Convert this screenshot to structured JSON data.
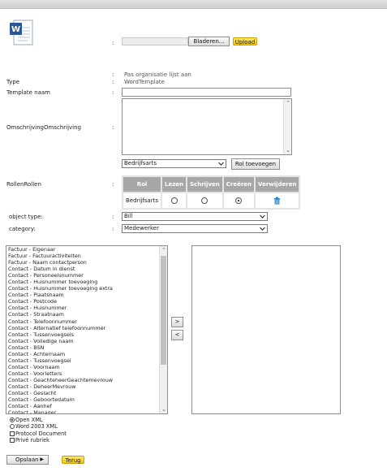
{
  "header": {},
  "upload": {
    "browse_label": "Bladeren...",
    "upload_label": "Upload"
  },
  "organisation_text": "Pas organisatie lijst aan",
  "type": {
    "label": "Type",
    "value": "WordTemplate"
  },
  "template_name": {
    "label": "Template naam",
    "value": ""
  },
  "description": {
    "label": "OmschrijvingOmschrijving",
    "value": ""
  },
  "role_select": {
    "value": "Bedrijfsarts",
    "add_label": "Rol toevoegen"
  },
  "roles": {
    "label": "RollenRollen",
    "headers": [
      "Rol",
      "Lezen",
      "Schrijven",
      "Creëren",
      "Verwijderen"
    ],
    "rows": [
      {
        "name": "Bedrijfsarts",
        "lezen": false,
        "schrijven": false,
        "creeren": true
      }
    ]
  },
  "object_type": {
    "label": "object type:",
    "value": "Bill"
  },
  "category": {
    "label": "category:",
    "value": "Medewerker"
  },
  "fields_list": [
    "Factuur - Eigenaar",
    "Factuur - Factuuractiviteiten",
    "Factuur - Naam contactperson",
    "Contact - Datum in dienst",
    "Contact - Personeelsnummer",
    "Contact - Huisnummer toevoeging",
    "Contact - Huisnummer toevoeging extra",
    "Contact - Plaatsnaam",
    "Contact - Postcode",
    "Contact - Huisnummer",
    "Contact - Straatnaam",
    "Contact - Telefoonnummer",
    "Contact - Alternatief telefoonnummer",
    "Contact - Tussenvoegsels",
    "Contact - Volledige naam",
    "Contact - BSN",
    "Contact - Achternaam",
    "Contact - Tussenvoegsel",
    "Contact - Voornaam",
    "Contact - Voorletters",
    "Contact - GeachteheerGeachtemevrouw",
    "Contact - DeheerMevrouw",
    "Contact - Geslacht",
    "Contact - Geboortedatum",
    "Contact - Aanhef",
    "Contact - Manager"
  ],
  "move_right_label": ">",
  "move_left_label": "<",
  "format_options": [
    {
      "label": "Open XML",
      "selected": true
    },
    {
      "label": "Word 2003 XML",
      "selected": false
    }
  ],
  "checkbox_options": [
    {
      "label": "Protocol Document",
      "checked": false
    },
    {
      "label": "Privé rubriek",
      "checked": false
    }
  ],
  "footer": {
    "save_label": "Opslaan",
    "back_label": "Terug"
  },
  "colors": {
    "accent": "#f6c400",
    "header_grey": "#a7a7a7",
    "selected_list": "#8c8c8c"
  }
}
